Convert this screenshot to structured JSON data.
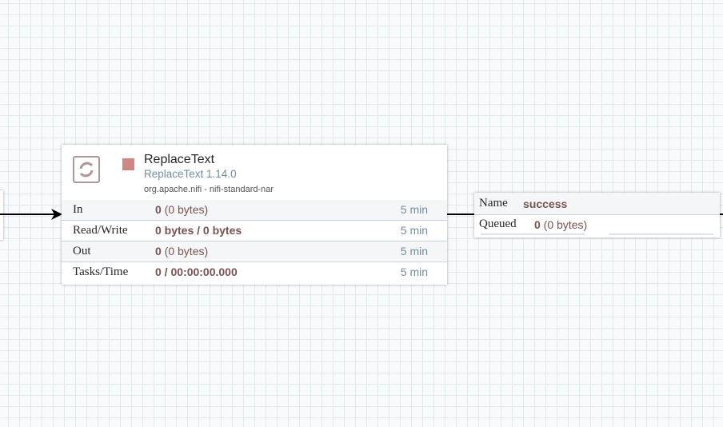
{
  "processor": {
    "name": "ReplaceText",
    "type": "ReplaceText 1.14.0",
    "bundle": "org.apache.nifi - nifi-standard-nar",
    "status": "stopped",
    "status_color": "#d18686",
    "stats": [
      {
        "label": "In",
        "count": "0",
        "detail": " (0 bytes)",
        "period": "5 min"
      },
      {
        "label": "Read/Write",
        "count": "0 bytes / 0 bytes",
        "detail": "",
        "period": "5 min"
      },
      {
        "label": "Out",
        "count": "0",
        "detail": " (0 bytes)",
        "period": "5 min"
      },
      {
        "label": "Tasks/Time",
        "count": "0 / 00:00:00.000",
        "detail": "",
        "period": "5 min"
      }
    ]
  },
  "connection": {
    "name_label": "Name",
    "name": "success",
    "queued_label": "Queued",
    "queued_count": "0",
    "queued_detail": " (0 bytes)"
  }
}
